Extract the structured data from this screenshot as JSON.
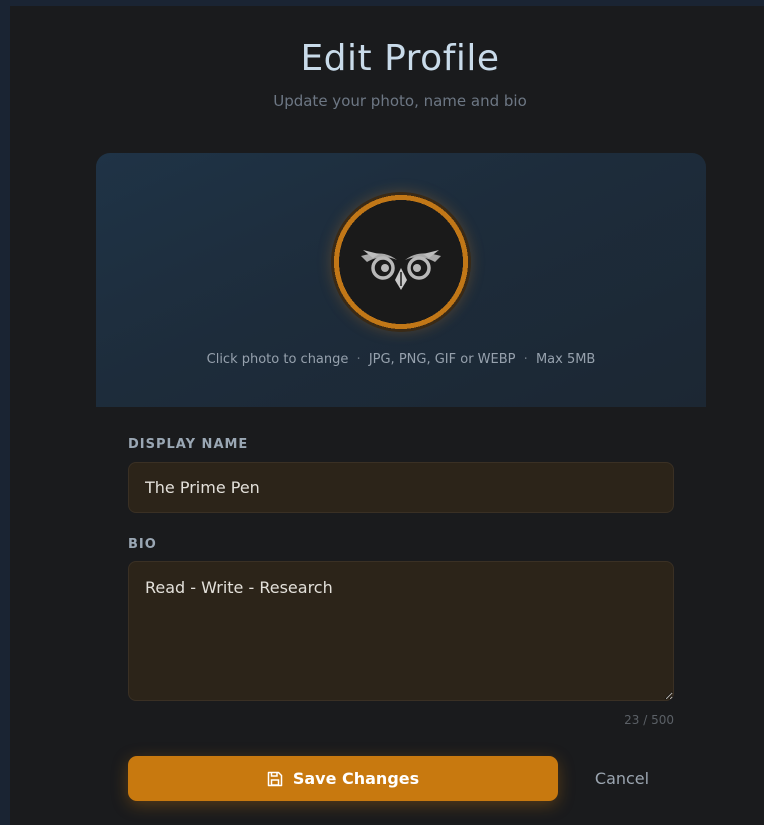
{
  "header": {
    "title": "Edit Profile",
    "subtitle": "Update your photo, name and bio"
  },
  "photo": {
    "hint_click": "Click photo to change",
    "separator": "·",
    "hint_formats": "JPG, PNG, GIF or WEBP",
    "hint_size": "Max 5MB",
    "avatar_icon": "owl-icon",
    "ring_color": "#c17717"
  },
  "form": {
    "display_name_label": "DISPLAY NAME",
    "display_name_value": "The Prime Pen",
    "bio_label": "BIO",
    "bio_value": "Read - Write - Research",
    "bio_counter": "23 / 500"
  },
  "actions": {
    "save_label": "Save Changes",
    "save_icon": "floppy-disk-icon",
    "cancel_label": "Cancel",
    "accent_color": "#c8790f"
  }
}
